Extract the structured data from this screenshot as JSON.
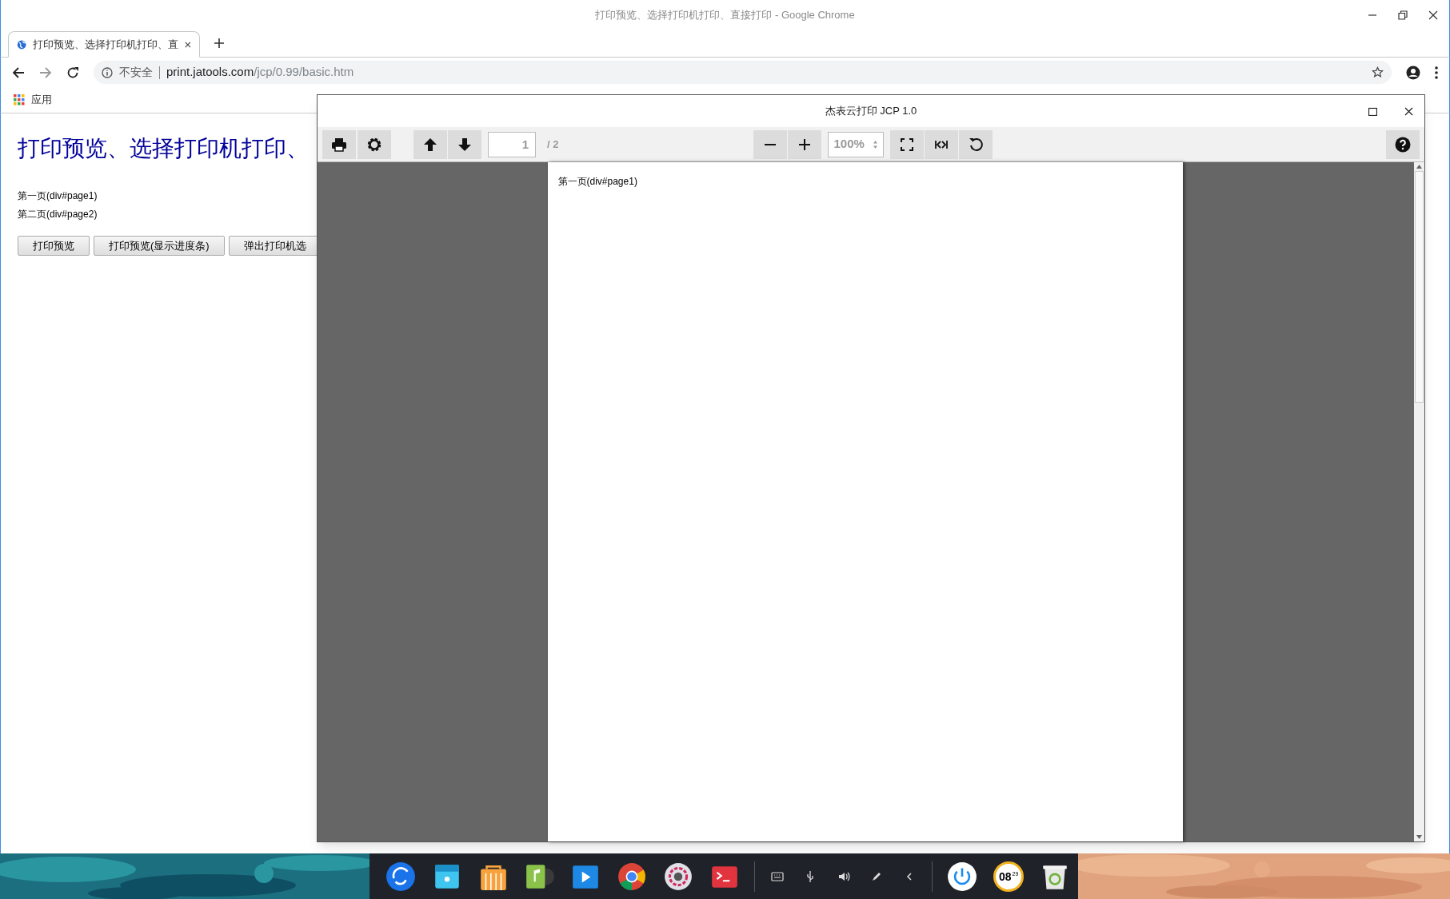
{
  "window": {
    "title": "打印预览、选择打印机打印、直接打印 - Google Chrome"
  },
  "tabs": [
    {
      "label": "打印预览、选择打印机打印、直",
      "selected": true
    }
  ],
  "address_bar": {
    "security": "不安全",
    "host": "print.jatools.com",
    "path": "/jcp/0.99/basic.htm"
  },
  "bookmarks": [
    {
      "label": "应用"
    }
  ],
  "page": {
    "heading": "打印预览、选择打印机打印、",
    "lines": [
      "第一页(div#page1)",
      "第二页(div#page2)"
    ],
    "buttons": [
      "打印预览",
      "打印预览(显示进度条)",
      "弹出打印机选"
    ]
  },
  "dialog": {
    "title": "杰表云打印 JCP 1.0",
    "page_input": "1",
    "page_total": "/ 2",
    "zoom": "100%",
    "preview_text": "第一页(div#page1)"
  },
  "taskbar": {
    "apps": [
      {
        "kind": "launcher"
      },
      {
        "kind": "files"
      },
      {
        "kind": "store"
      },
      {
        "kind": "music"
      },
      {
        "kind": "video"
      },
      {
        "kind": "browser"
      },
      {
        "kind": "settings"
      },
      {
        "kind": "terminal"
      }
    ],
    "tray": [
      {
        "kind": "keyboard"
      },
      {
        "kind": "usb"
      },
      {
        "kind": "volume"
      },
      {
        "kind": "pen"
      },
      {
        "kind": "chevron"
      }
    ],
    "clock": {
      "hour": "08",
      "minute": "29"
    }
  }
}
